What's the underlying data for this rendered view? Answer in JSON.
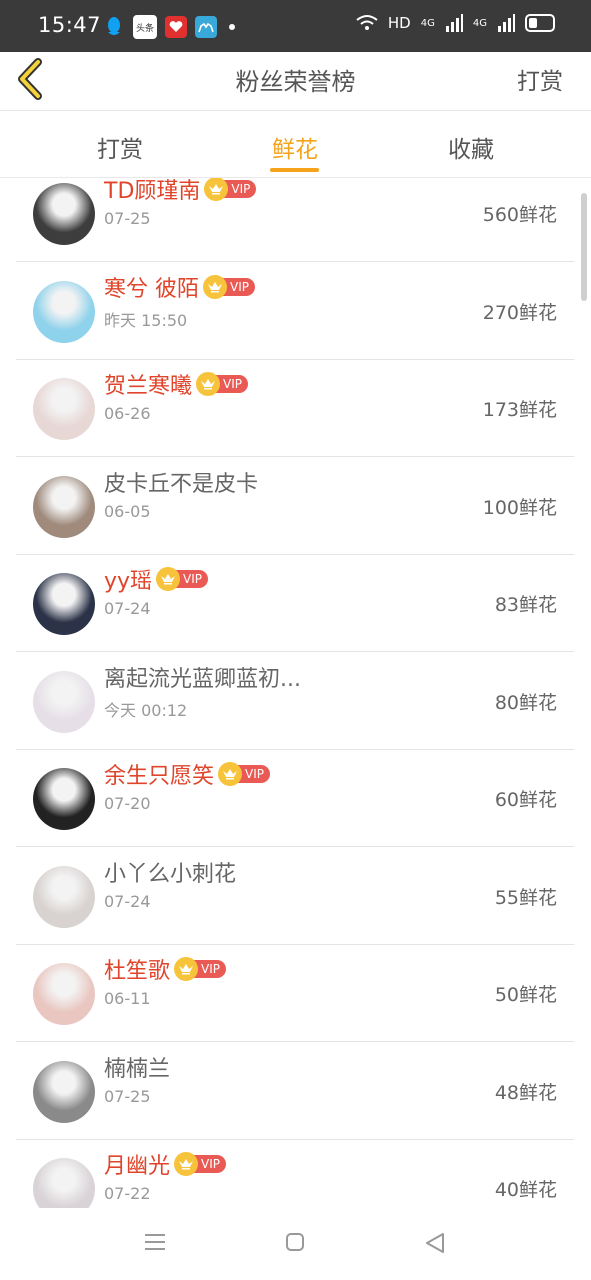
{
  "status_bar": {
    "time": "15:47",
    "apps": [
      {
        "icon": "qq-icon",
        "color": "#12a0f0"
      },
      {
        "icon": "toutiao-icon",
        "label": "头条",
        "color": "#ffffff"
      },
      {
        "icon": "heart-app-icon",
        "color": "#e03030"
      },
      {
        "icon": "camel-app-icon",
        "color": "#39a9d9"
      }
    ],
    "network": "HD",
    "signal1": "4G",
    "signal2": "4G"
  },
  "header": {
    "title": "粉丝荣誉榜",
    "action": "打赏"
  },
  "tabs": [
    {
      "label": "打赏",
      "active": false
    },
    {
      "label": "鲜花",
      "active": true
    },
    {
      "label": "收藏",
      "active": false
    }
  ],
  "colors": {
    "accent": "#f5a31a",
    "vip_name": "#e0452b",
    "vip_badge": "#ea5a55",
    "crown": "#f7c33a"
  },
  "vip_label": "VIP",
  "fans": [
    {
      "name": "TD顾瑾南",
      "vip": true,
      "time": "07-25",
      "amount": "560鲜花",
      "avatar_color": "#3d3d3d"
    },
    {
      "name": "寒兮 彼陌",
      "vip": true,
      "time": "昨天 15:50",
      "amount": "270鲜花",
      "avatar_color": "#8fd2ec"
    },
    {
      "name": "贺兰寒曦",
      "vip": true,
      "time": "06-26",
      "amount": "173鲜花",
      "avatar_color": "#e7d7d5"
    },
    {
      "name": "皮卡丘不是皮卡",
      "vip": false,
      "time": "06-05",
      "amount": "100鲜花",
      "avatar_color": "#9f8a7c"
    },
    {
      "name": "yy瑶",
      "vip": true,
      "time": "07-24",
      "amount": "83鲜花",
      "avatar_color": "#2c3348"
    },
    {
      "name": "离起流光蓝卿蓝初...",
      "vip": false,
      "time": "今天 00:12",
      "amount": "80鲜花",
      "avatar_color": "#e6dfe8"
    },
    {
      "name": "余生只愿笑",
      "vip": true,
      "time": "07-20",
      "amount": "60鲜花",
      "avatar_color": "#222222"
    },
    {
      "name": "小丫么小刺花",
      "vip": false,
      "time": "07-24",
      "amount": "55鲜花",
      "avatar_color": "#d8d2d0"
    },
    {
      "name": "杜笙歌",
      "vip": true,
      "time": "06-11",
      "amount": "50鲜花",
      "avatar_color": "#e9c6c0"
    },
    {
      "name": "楠楠兰",
      "vip": false,
      "time": "07-25",
      "amount": "48鲜花",
      "avatar_color": "#8a8a8a"
    },
    {
      "name": "月幽光",
      "vip": true,
      "time": "07-22",
      "amount": "40鲜花",
      "avatar_color": "#d9d2d6"
    }
  ]
}
